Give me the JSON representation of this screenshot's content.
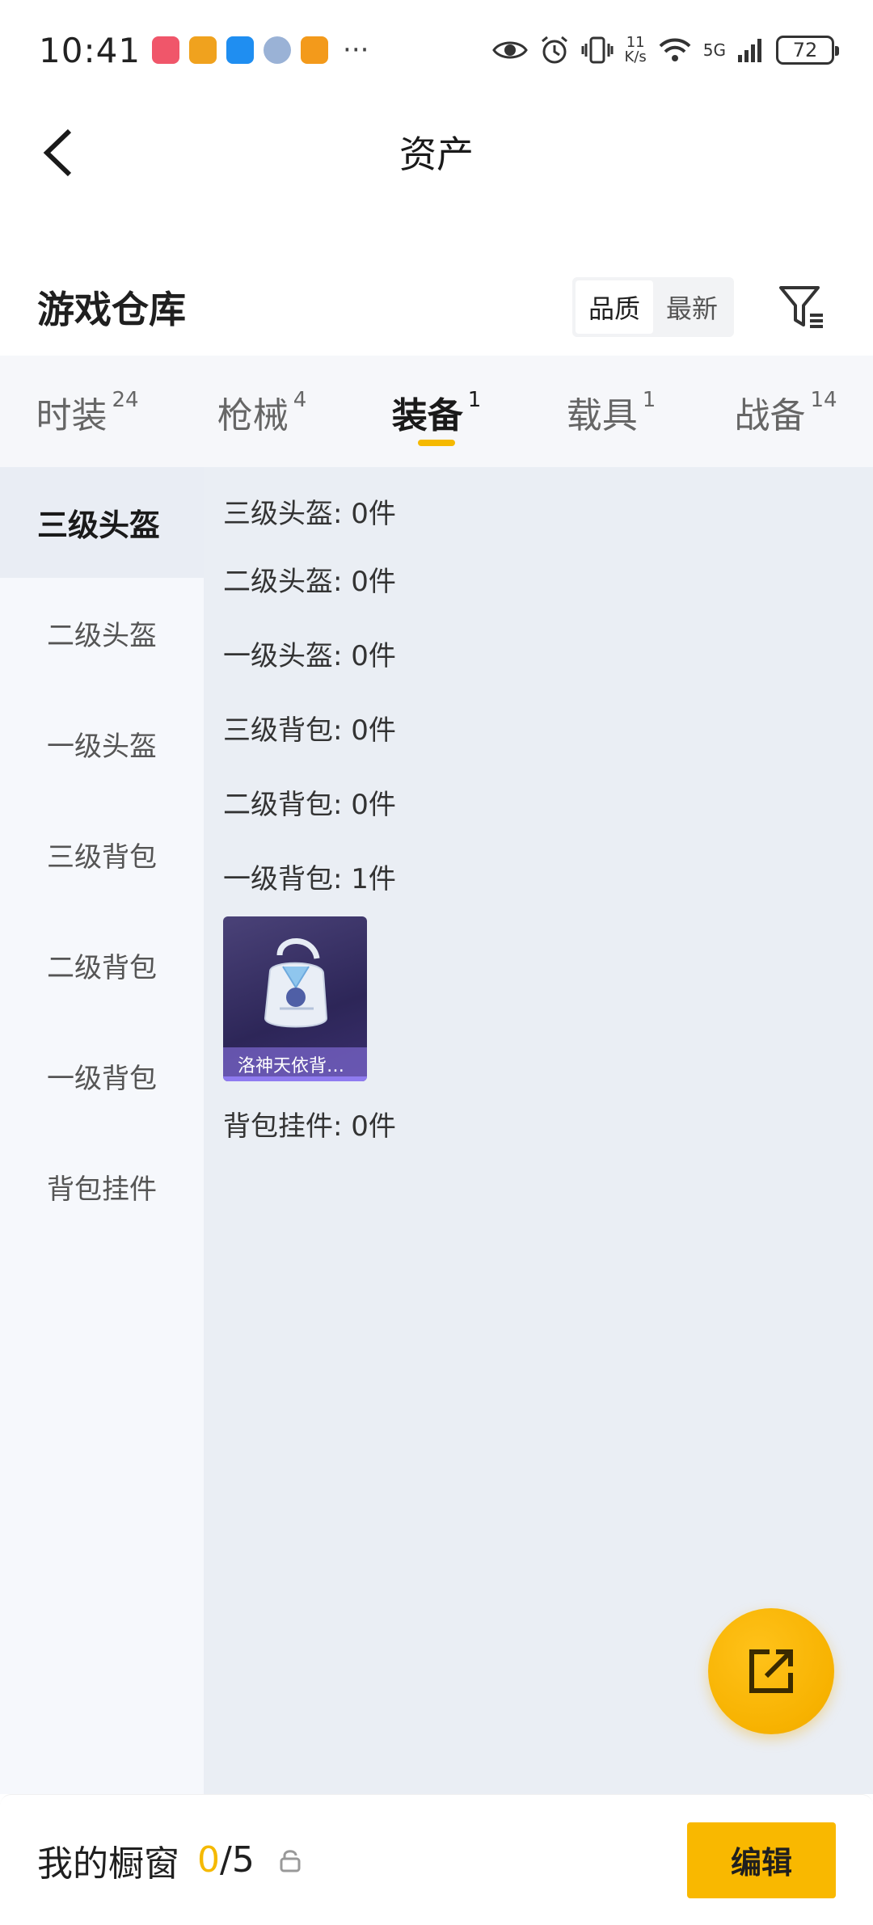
{
  "status_bar": {
    "time": "10:41",
    "more": "···",
    "net_speed_value": "11",
    "net_speed_unit": "K/s",
    "signal_label": "5G",
    "battery": "72"
  },
  "nav": {
    "title": "资产"
  },
  "section": {
    "title": "游戏仓库",
    "sort_options": [
      "品质",
      "最新"
    ],
    "active_sort": "品质"
  },
  "tabs": [
    {
      "label": "时装",
      "count": "24"
    },
    {
      "label": "枪械",
      "count": "4"
    },
    {
      "label": "装备",
      "count": "1",
      "active": true
    },
    {
      "label": "载具",
      "count": "1"
    },
    {
      "label": "战备",
      "count": "14"
    }
  ],
  "side_nav": [
    "三级头盔",
    "二级头盔",
    "一级头盔",
    "三级背包",
    "二级背包",
    "一级背包",
    "背包挂件"
  ],
  "groups": [
    {
      "label": "三级头盔: 0件"
    },
    {
      "label": "二级头盔: 0件"
    },
    {
      "label": "一级头盔: 0件"
    },
    {
      "label": "三级背包: 0件"
    },
    {
      "label": "二级背包: 0件"
    },
    {
      "label": "一级背包: 1件",
      "items": [
        {
          "name": "洛神天依背…"
        }
      ]
    },
    {
      "label": "背包挂件: 0件"
    }
  ],
  "bottom": {
    "showcase_label": "我的橱窗",
    "showcase_current": "0",
    "showcase_total": "/5",
    "edit_label": "编辑"
  },
  "colors": {
    "accent": "#f5b900",
    "button": "#f9b800",
    "item_card": "#3a3168"
  }
}
